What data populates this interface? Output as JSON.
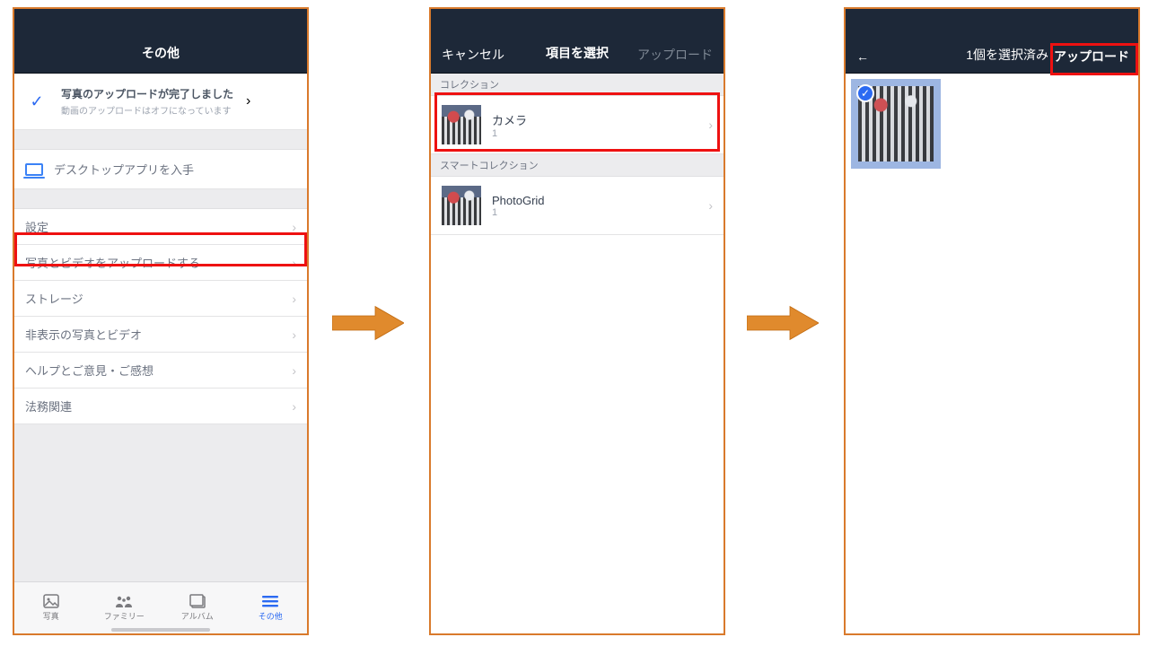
{
  "phone1": {
    "header_title": "その他",
    "upload_status_title": "写真のアップロードが完了しました",
    "upload_status_sub": "動画のアップロードはオフになっています",
    "desktop_app": "デスクトップアプリを入手",
    "items": [
      "設定",
      "写真とビデオをアップロードする",
      "ストレージ",
      "非表示の写真とビデオ",
      "ヘルプとご意見・ご感想",
      "法務関連"
    ],
    "tabs": {
      "photos": "写真",
      "family": "ファミリー",
      "album": "アルバム",
      "more": "その他"
    }
  },
  "phone2": {
    "cancel": "キャンセル",
    "title": "項目を選択",
    "upload": "アップロード",
    "section_collection": "コレクション",
    "section_smart": "スマートコレクション",
    "rows": [
      {
        "name": "カメラ",
        "count": "1"
      },
      {
        "name": "PhotoGrid",
        "count": "1"
      }
    ]
  },
  "phone3": {
    "selected_text": "1個を選択済み",
    "upload": "アップロード"
  }
}
